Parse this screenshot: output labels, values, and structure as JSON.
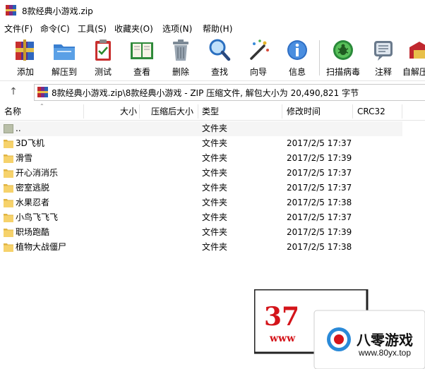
{
  "window": {
    "title": "8款经典小游戏.zip"
  },
  "menu": [
    {
      "label": "文件(F)"
    },
    {
      "label": "命令(C)"
    },
    {
      "label": "工具(S)"
    },
    {
      "label": "收藏夹(O)"
    },
    {
      "label": "选项(N)"
    },
    {
      "label": "帮助(H)"
    }
  ],
  "toolbar": [
    {
      "label": "添加",
      "icon": "add-books-icon"
    },
    {
      "label": "解压到",
      "icon": "extract-folder-icon"
    },
    {
      "label": "测试",
      "icon": "test-clipboard-icon"
    },
    {
      "label": "查看",
      "icon": "view-book-icon"
    },
    {
      "label": "删除",
      "icon": "trash-icon"
    },
    {
      "label": "查找",
      "icon": "magnifier-icon"
    },
    {
      "label": "向导",
      "icon": "wizard-wand-icon"
    },
    {
      "label": "信息",
      "icon": "info-icon"
    },
    {
      "label": "扫描病毒",
      "icon": "virus-scan-icon"
    },
    {
      "label": "注释",
      "icon": "comment-icon"
    },
    {
      "label": "自解压",
      "icon": "sfx-icon"
    }
  ],
  "address": {
    "text": "8款经典小游戏.zip\\8款经典小游戏 - ZIP 压缩文件, 解包大小为 20,490,821 字节"
  },
  "columns": {
    "name": "名称",
    "size": "大小",
    "packed": "压缩后大小",
    "type": "类型",
    "modified": "修改时间",
    "crc": "CRC32"
  },
  "files": [
    {
      "name": "..",
      "type": "文件夹",
      "modified": ""
    },
    {
      "name": "3D飞机",
      "type": "文件夹",
      "modified": "2017/2/5 17:37"
    },
    {
      "name": "滑雪",
      "type": "文件夹",
      "modified": "2017/2/5 17:39"
    },
    {
      "name": "开心消消乐",
      "type": "文件夹",
      "modified": "2017/2/5 17:37"
    },
    {
      "name": "密室逃脱",
      "type": "文件夹",
      "modified": "2017/2/5 17:37"
    },
    {
      "name": "水果忍者",
      "type": "文件夹",
      "modified": "2017/2/5 17:38"
    },
    {
      "name": "小鸟飞飞飞",
      "type": "文件夹",
      "modified": "2017/2/5 17:37"
    },
    {
      "name": "职场跑酷",
      "type": "文件夹",
      "modified": "2017/2/5 17:39"
    },
    {
      "name": "植物大战僵尸",
      "type": "文件夹",
      "modified": "2017/2/5 17:38"
    }
  ],
  "watermark": {
    "brand1": "37",
    "brand1_url": "www",
    "brand2": "八零游戏",
    "brand2_url": "www.80yx.top"
  },
  "colors": {
    "folder": "#f6d26b",
    "folder_dark": "#e0b443",
    "brand_red": "#d4141a"
  }
}
